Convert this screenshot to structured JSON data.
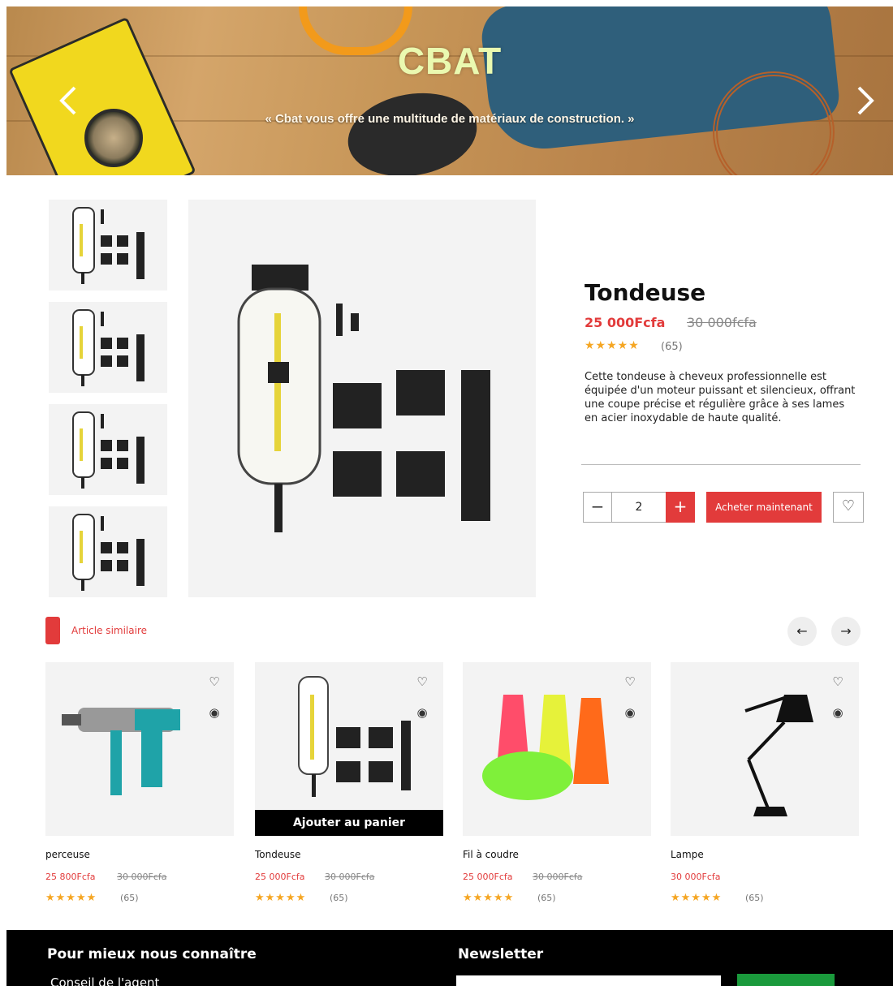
{
  "hero": {
    "title": "CBAT",
    "subtitle": "« Cbat vous offre une multitude de matériaux de construction. »",
    "prev_icon": "chevron-left-icon",
    "next_icon": "chevron-right-icon"
  },
  "product": {
    "name": "Tondeuse",
    "price": "25 000Fcfa",
    "old_price": "30 000fcfa",
    "stars": "★★★★★",
    "review_count": "(65)",
    "description": "Cette tondeuse à cheveux professionnelle est équipée d'un moteur puissant et silencieux, offrant une coupe précise et régulière grâce à ses lames en acier inoxydable de haute qualité.",
    "quantity": "2",
    "minus": "−",
    "plus": "+",
    "buy_label": "Acheter maintenant",
    "wish_icon": "♡"
  },
  "related": {
    "title": "Article similaire",
    "prev": "←",
    "next": "→",
    "add_to_cart": "Ajouter au panier",
    "items": [
      {
        "name": "perceuse",
        "price": "25 800Fcfa",
        "old_price": "30 000Fcfa",
        "stars": "★★★★★",
        "count": "(65)"
      },
      {
        "name": "Tondeuse",
        "price": "25 000Fcfa",
        "old_price": "30 000Fcfa",
        "stars": "★★★★★",
        "count": "(65)"
      },
      {
        "name": "Fil à coudre",
        "price": "25 000Fcfa",
        "old_price": "30 000Fcfa",
        "stars": "★★★★★",
        "count": "(65)"
      },
      {
        "name": "Lampe",
        "price": "30 000Fcfa",
        "old_price": "",
        "stars": "★★★★★",
        "count": "(65)"
      }
    ]
  },
  "footer": {
    "about_title": "Pour mieux nous connaître",
    "link_1": "Conseil de l'agent",
    "newsletter_title": "Newsletter"
  },
  "colors": {
    "accent_red": "#e23b3b",
    "star": "#f5a623",
    "newsletter_button": "#1a9a3c"
  }
}
